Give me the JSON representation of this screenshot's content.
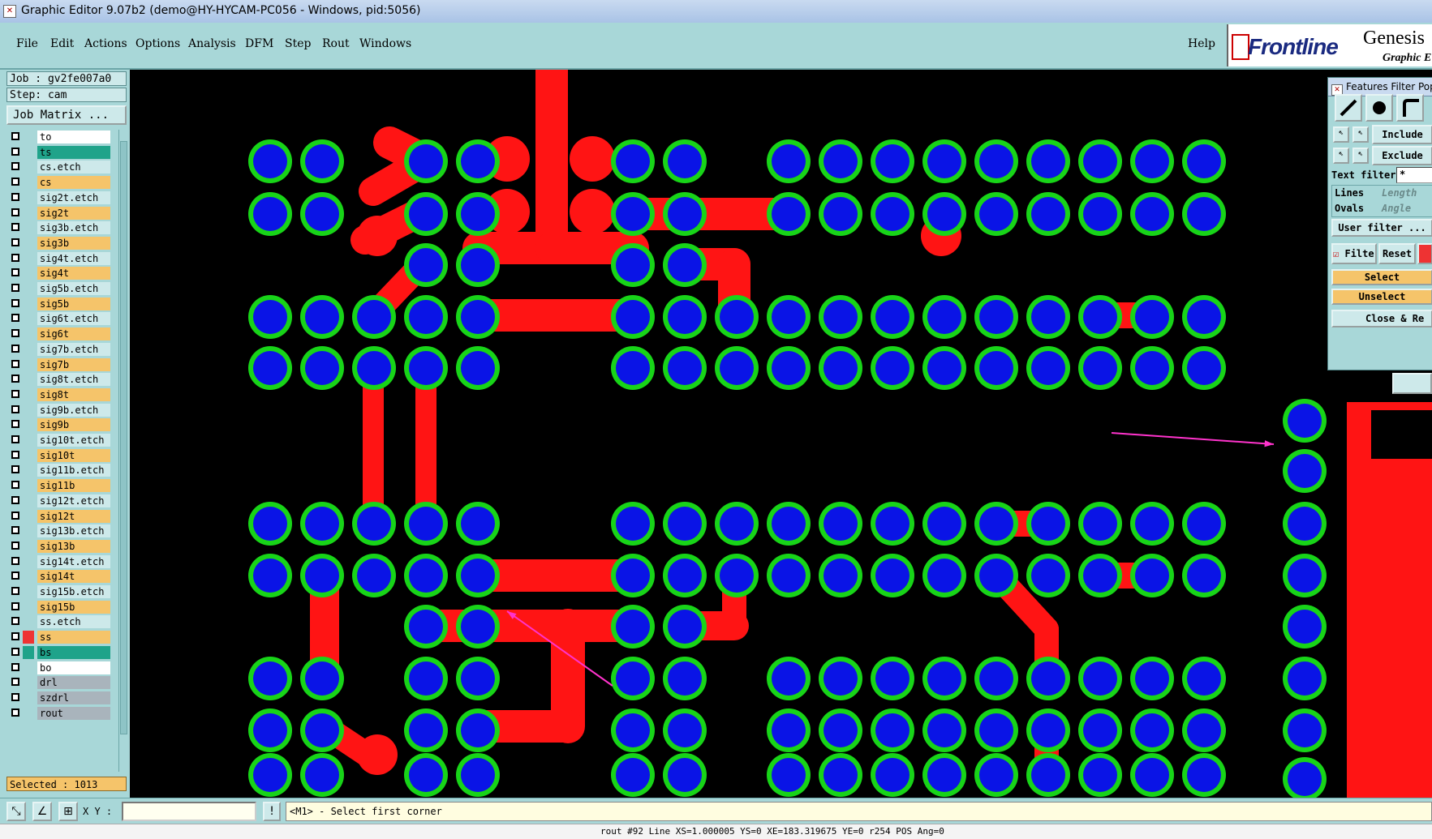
{
  "window": {
    "title": "Graphic Editor 9.07b2 (demo@HY-HYCAM-PC056 - Windows, pid:5056)"
  },
  "menu": {
    "file": "File",
    "edit": "Edit",
    "actions": "Actions",
    "options": "Options",
    "analysis": "Analysis",
    "dfm": "DFM",
    "step": "Step",
    "rout": "Rout",
    "windows": "Windows",
    "help": "Help"
  },
  "brand": {
    "logo": "Frontline",
    "product": "Genesis",
    "subtitle": "Graphic E"
  },
  "job": {
    "job_label": "Job : gv2fe007a0",
    "step_label": "Step: cam",
    "matrix_button": "Job Matrix ..."
  },
  "layers": [
    {
      "name": "to",
      "bg": "#ffffff"
    },
    {
      "name": "ts",
      "bg": "#1fa38a"
    },
    {
      "name": "cs.etch",
      "bg": "#cde9ea"
    },
    {
      "name": "cs",
      "bg": "#f5c46a"
    },
    {
      "name": "sig2t.etch",
      "bg": "#cde9ea"
    },
    {
      "name": "sig2t",
      "bg": "#f5c46a"
    },
    {
      "name": "sig3b.etch",
      "bg": "#cde9ea"
    },
    {
      "name": "sig3b",
      "bg": "#f5c46a"
    },
    {
      "name": "sig4t.etch",
      "bg": "#cde9ea"
    },
    {
      "name": "sig4t",
      "bg": "#f5c46a"
    },
    {
      "name": "sig5b.etch",
      "bg": "#cde9ea"
    },
    {
      "name": "sig5b",
      "bg": "#f5c46a"
    },
    {
      "name": "sig6t.etch",
      "bg": "#cde9ea"
    },
    {
      "name": "sig6t",
      "bg": "#f5c46a"
    },
    {
      "name": "sig7b.etch",
      "bg": "#cde9ea"
    },
    {
      "name": "sig7b",
      "bg": "#f5c46a"
    },
    {
      "name": "sig8t.etch",
      "bg": "#cde9ea"
    },
    {
      "name": "sig8t",
      "bg": "#f5c46a"
    },
    {
      "name": "sig9b.etch",
      "bg": "#cde9ea"
    },
    {
      "name": "sig9b",
      "bg": "#f5c46a"
    },
    {
      "name": "sig10t.etch",
      "bg": "#cde9ea"
    },
    {
      "name": "sig10t",
      "bg": "#f5c46a"
    },
    {
      "name": "sig11b.etch",
      "bg": "#cde9ea"
    },
    {
      "name": "sig11b",
      "bg": "#f5c46a"
    },
    {
      "name": "sig12t.etch",
      "bg": "#cde9ea"
    },
    {
      "name": "sig12t",
      "bg": "#f5c46a"
    },
    {
      "name": "sig13b.etch",
      "bg": "#cde9ea"
    },
    {
      "name": "sig13b",
      "bg": "#f5c46a"
    },
    {
      "name": "sig14t.etch",
      "bg": "#cde9ea"
    },
    {
      "name": "sig14t",
      "bg": "#f5c46a"
    },
    {
      "name": "sig15b.etch",
      "bg": "#cde9ea"
    },
    {
      "name": "sig15b",
      "bg": "#f5c46a"
    },
    {
      "name": "ss.etch",
      "bg": "#cde9ea"
    },
    {
      "name": "ss",
      "bg": "#f5c46a",
      "active": true
    },
    {
      "name": "bs",
      "bg": "#1fa38a",
      "active": true
    },
    {
      "name": "bo",
      "bg": "#ffffff"
    },
    {
      "name": "drl",
      "bg": "#a9b4bc"
    },
    {
      "name": "szdrl",
      "bg": "#a9b4bc"
    },
    {
      "name": "rout",
      "bg": "#a9b4bc"
    }
  ],
  "status": {
    "selected": "Selected : 1013",
    "xy_label": "X Y :",
    "message": "<M1> - Select first corner",
    "bottom": "rout #92 Line XS=1.000005 YS=0 XE=183.319675 YE=0 r254 POS Ang=0"
  },
  "features_filter": {
    "title": "Features Filter Pop",
    "include": "Include",
    "exclude": "Exclude",
    "text_filter_label": "Text filter",
    "text_filter_value": "*",
    "lines": "Lines",
    "ovals": "Ovals",
    "length": "Length",
    "angle": "Angle",
    "user_filter": "User filter ...",
    "filter": "Filter",
    "reset": "Reset",
    "select": "Select",
    "unselect": "Unselect",
    "close": "Close & Re"
  },
  "colors": {
    "pad": "#0a14e6",
    "ring": "#18d418",
    "trace": "#ff1414",
    "highlight": "#f5c46a",
    "arrow": "#ff33cc",
    "canvas_bg": "#000000"
  }
}
